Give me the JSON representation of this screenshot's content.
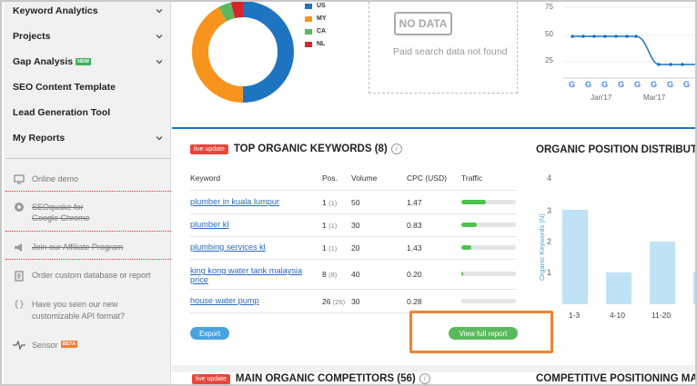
{
  "sidebar": {
    "nav": [
      {
        "label": "Keyword Analytics",
        "chevron": true
      },
      {
        "label": "Projects",
        "chevron": true
      },
      {
        "label": "Gap Analysis",
        "badge": "NEW",
        "chevron": true
      },
      {
        "label": "SEO Content Template",
        "chevron": false
      },
      {
        "label": "Lead Generation Tool",
        "chevron": false
      },
      {
        "label": "My Reports",
        "chevron": true
      }
    ],
    "links": [
      {
        "label": "Online demo",
        "icon": "monitor-icon"
      },
      {
        "label_line1": "SEOquake for",
        "label_line2": "Google Chrome",
        "icon": "seoquake-icon"
      },
      {
        "label": "Join our Affiliate Program",
        "icon": "megaphone-icon"
      },
      {
        "label": "Order custom database or report",
        "icon": "document-icon"
      },
      {
        "label_line1": "Have you seen our new",
        "label_line2": "customizable API format?",
        "icon": "braces-icon"
      },
      {
        "label": "Sensor",
        "badge": "BETA",
        "icon": "pulse-icon"
      }
    ]
  },
  "top": {
    "donut_legend": [
      {
        "code": "US",
        "color": "#1f74c1"
      },
      {
        "code": "MY",
        "color": "#f7941d"
      },
      {
        "code": "CA",
        "color": "#5cb85c"
      },
      {
        "code": "NL",
        "color": "#d9232e"
      }
    ],
    "nodata_tag": "NO DATA",
    "nodata_text": "Paid search data not found",
    "trend_ticks": [
      "75",
      "50",
      "25"
    ],
    "trend_months": [
      "Jan'17",
      "Mar'17"
    ]
  },
  "keywords": {
    "badge": "live update",
    "title": "TOP ORGANIC KEYWORDS (8)",
    "columns": [
      "Keyword",
      "Pos.",
      "Volume",
      "CPC (USD)",
      "Traffic"
    ],
    "rows": [
      {
        "keyword": "plumber in kuala lumpur",
        "pos": "1",
        "pos_prev": "(1)",
        "volume": "50",
        "cpc": "1.47",
        "traffic": 0.45
      },
      {
        "keyword": "plumber kl",
        "pos": "1",
        "pos_prev": "(1)",
        "volume": "30",
        "cpc": "0.83",
        "traffic": 0.28
      },
      {
        "keyword": "plumbing services kl",
        "pos": "1",
        "pos_prev": "(1)",
        "volume": "20",
        "cpc": "1.43",
        "traffic": 0.18
      },
      {
        "keyword_line1": "king kong water tank malaysia",
        "keyword_line2": "price",
        "pos": "8",
        "pos_prev": "(8)",
        "volume": "40",
        "cpc": "0.20",
        "traffic": 0.03
      },
      {
        "keyword": "house water pump",
        "pos": "26",
        "pos_prev": "(26)",
        "volume": "30",
        "cpc": "0.28",
        "traffic": 0.0
      }
    ],
    "export_label": "Export",
    "full_report_label": "View full report"
  },
  "position_chart": {
    "title": "ORGANIC POSITION DISTRIBUT",
    "ylabel": "Organic Keywords (N)",
    "chart_data": {
      "type": "bar",
      "categories": [
        "1-3",
        "4-10",
        "11-20",
        ""
      ],
      "values": [
        3,
        1,
        2,
        1
      ],
      "ylabel": "Organic Keywords (N)",
      "ylim": [
        0,
        4
      ],
      "yticks": [
        "4",
        "3",
        "2",
        "1"
      ]
    }
  },
  "competitors": {
    "badge": "live update",
    "title": "MAIN ORGANIC COMPETITORS (56)"
  },
  "positioning": {
    "title": "COMPETITIVE POSITIONING MA"
  }
}
